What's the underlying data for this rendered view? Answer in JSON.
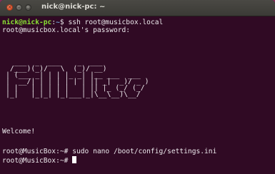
{
  "window": {
    "title": "nick@nick-pc: ~",
    "close_glyph": "×",
    "minimize_glyph": "–",
    "maximize_glyph": "□"
  },
  "terminal": {
    "line1": {
      "user_host": "nick@nick-pc",
      "sep": ":",
      "path": "~",
      "suffix": "$ ",
      "command": "ssh root@musicbox.local"
    },
    "line2": "root@musicbox.local's password:",
    "banner": "  ___  _  ___    _  ___\n /___)(_)/   \\  (_)/ __)\n| (___ _| | | |_ _| |__ ___  ___\n|  __/| | | | | | | || _|  _)/ _ )\n| |   | | | | |   | || |_ (_/ (_/\n|_|   |_|_| |_|___|_|\\__\\__)\\__/",
    "welcome": "Welcome!",
    "line4": "root@MusicBox:~# sudo nano /boot/config/settings.ini",
    "line5": "root@MusicBox:~# "
  },
  "colors": {
    "background": "#300a24",
    "titlebar": "#3b3a36",
    "prompt_user": "#8ae234",
    "prompt_path": "#729fcf",
    "text": "#ece8ec"
  },
  "icons": {
    "close": "close-icon",
    "minimize": "minimize-icon",
    "maximize": "maximize-icon"
  }
}
